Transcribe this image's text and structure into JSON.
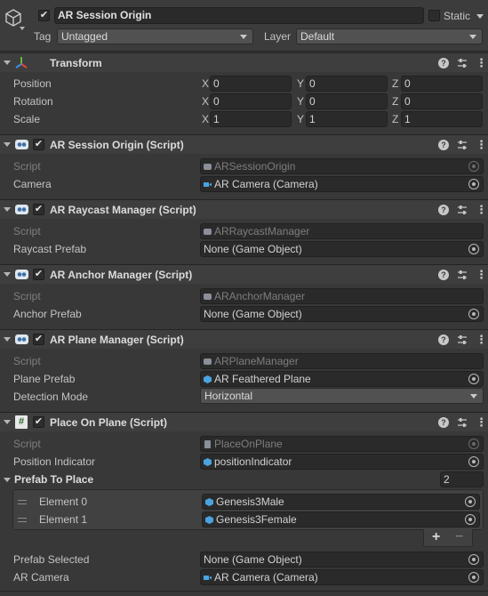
{
  "object": {
    "name": "AR Session Origin",
    "active": true,
    "static_label": "Static",
    "static_checked": false,
    "tag_label": "Tag",
    "tag_value": "Untagged",
    "layer_label": "Layer",
    "layer_value": "Default"
  },
  "transform": {
    "title": "Transform",
    "rows": [
      {
        "label": "Position",
        "x": "0",
        "y": "0",
        "z": "0"
      },
      {
        "label": "Rotation",
        "x": "0",
        "y": "0",
        "z": "0"
      },
      {
        "label": "Scale",
        "x": "1",
        "y": "1",
        "z": "1"
      }
    ],
    "axis_x": "X",
    "axis_y": "Y",
    "axis_z": "Z"
  },
  "components": {
    "session_origin": {
      "title": "AR Session Origin (Script)",
      "script_label": "Script",
      "script_value": "ARSessionOrigin",
      "field_label": "Camera",
      "field_value": "AR Camera (Camera)"
    },
    "raycast": {
      "title": "AR Raycast Manager (Script)",
      "script_label": "Script",
      "script_value": "ARRaycastManager",
      "field_label": "Raycast Prefab",
      "field_value": "None (Game Object)"
    },
    "anchor": {
      "title": "AR Anchor Manager (Script)",
      "script_label": "Script",
      "script_value": "ARAnchorManager",
      "field_label": "Anchor Prefab",
      "field_value": "None (Game Object)"
    },
    "plane": {
      "title": "AR Plane Manager (Script)",
      "script_label": "Script",
      "script_value": "ARPlaneManager",
      "plane_prefab_label": "Plane Prefab",
      "plane_prefab_value": "AR Feathered Plane",
      "detection_label": "Detection Mode",
      "detection_value": "Horizontal"
    },
    "place_on_plane": {
      "title": "Place On Plane (Script)",
      "script_label": "Script",
      "script_value": "PlaceOnPlane",
      "indicator_label": "Position Indicator",
      "indicator_value": "positionIndicator",
      "prefab_list_label": "Prefab To Place",
      "prefab_list_count": "2",
      "elements": [
        {
          "label": "Element 0",
          "value": "Genesis3Male"
        },
        {
          "label": "Element 1",
          "value": "Genesis3Female"
        }
      ],
      "add_label": "+",
      "remove_label": "−",
      "prefab_selected_label": "Prefab Selected",
      "prefab_selected_value": "None (Game Object)",
      "ar_camera_label": "AR Camera",
      "ar_camera_value": "AR Camera (Camera)"
    }
  },
  "icons": {
    "gameobject": "cube-icon",
    "transform": "transform-axes-icon",
    "script": "script-icon",
    "help": "help-icon",
    "presets": "presets-icon",
    "menu": "kebab-menu-icon",
    "object_picker": "object-picker-icon"
  },
  "colors": {
    "background": "#383838",
    "header": "#3e3e3e",
    "field": "#2a2a2a",
    "camera_blue": "#4aa3df",
    "prefab_blue": "#4aa3df",
    "csharp_green": "#58a84d"
  }
}
